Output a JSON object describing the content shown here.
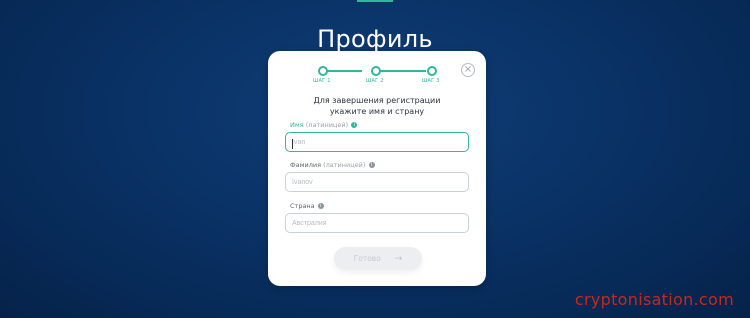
{
  "page": {
    "title": "Профиль"
  },
  "card": {
    "close_icon": "×",
    "steps": [
      {
        "label": "ШАГ 1",
        "state": "completed"
      },
      {
        "label": "ШАГ 2",
        "state": "completed"
      },
      {
        "label": "ШАГ 3",
        "state": "current"
      }
    ],
    "subtitle_line1": "Для завершения регистрации",
    "subtitle_line2": "укажите имя и страну",
    "fields": [
      {
        "label": "Имя",
        "hint": "(латиницей)",
        "placeholder": "Ivan",
        "value": "",
        "focused": true
      },
      {
        "label": "Фамилия",
        "hint": "(латиницей)",
        "placeholder": "Ivanov",
        "value": "",
        "focused": false
      },
      {
        "label": "Страна",
        "hint": "",
        "placeholder": "Австралия",
        "value": "",
        "focused": false
      }
    ],
    "info_icon": "i",
    "submit": {
      "label": "Готово",
      "arrow": "→"
    }
  },
  "watermark": "cryptonisation.com",
  "colors": {
    "accent": "#2fb89a",
    "background": "#0a3266",
    "watermark": "#c4291f"
  }
}
